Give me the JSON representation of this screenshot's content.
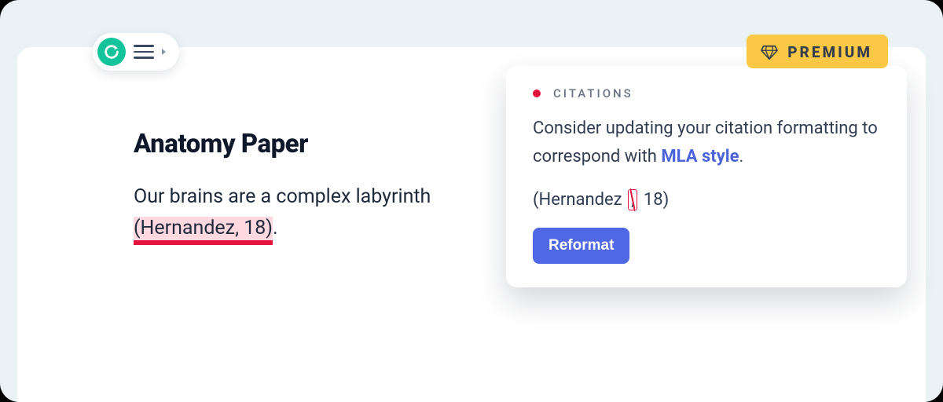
{
  "document": {
    "title": "Anatomy Paper",
    "body_prefix": "Our brains are a complex labyrinth ",
    "citation_text": "(Hernandez, 18)",
    "body_suffix": "."
  },
  "premium": {
    "label": "PREMIUM"
  },
  "suggestion": {
    "category": "CITATIONS",
    "message_prefix": "Consider updating your citation formatting to correspond with ",
    "style_name": "MLA style",
    "message_suffix": ".",
    "example_prefix": "(Hernandez",
    "example_strike": ",",
    "example_suffix": "18)",
    "action_label": "Reformat"
  },
  "colors": {
    "accent_red": "#e5123d",
    "premium_yellow": "#fbc846",
    "link_blue": "#4b63d8",
    "button_blue": "#5068e4",
    "brand_green": "#15c39a"
  }
}
